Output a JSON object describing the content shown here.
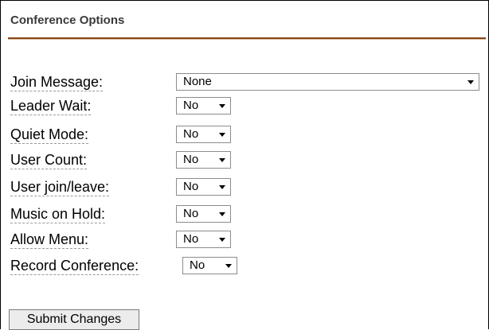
{
  "section": {
    "title": "Conference Options"
  },
  "colors": {
    "rule": "#8b4513",
    "label_underline": "#9a9a9a"
  },
  "fields": [
    {
      "label": "Join Message:",
      "value": "None"
    },
    {
      "label": "Leader Wait:",
      "value": "No"
    },
    {
      "label": "Quiet Mode:",
      "value": "No"
    },
    {
      "label": "User Count:",
      "value": "No"
    },
    {
      "label": "User join/leave:",
      "value": "No"
    },
    {
      "label": "Music on Hold:",
      "value": "No"
    },
    {
      "label": "Allow Menu:",
      "value": "No"
    },
    {
      "label": "Record Conference:",
      "value": "No"
    }
  ],
  "submit_label": "Submit Changes",
  "icons": {
    "dropdown": "chevron-down-icon"
  }
}
